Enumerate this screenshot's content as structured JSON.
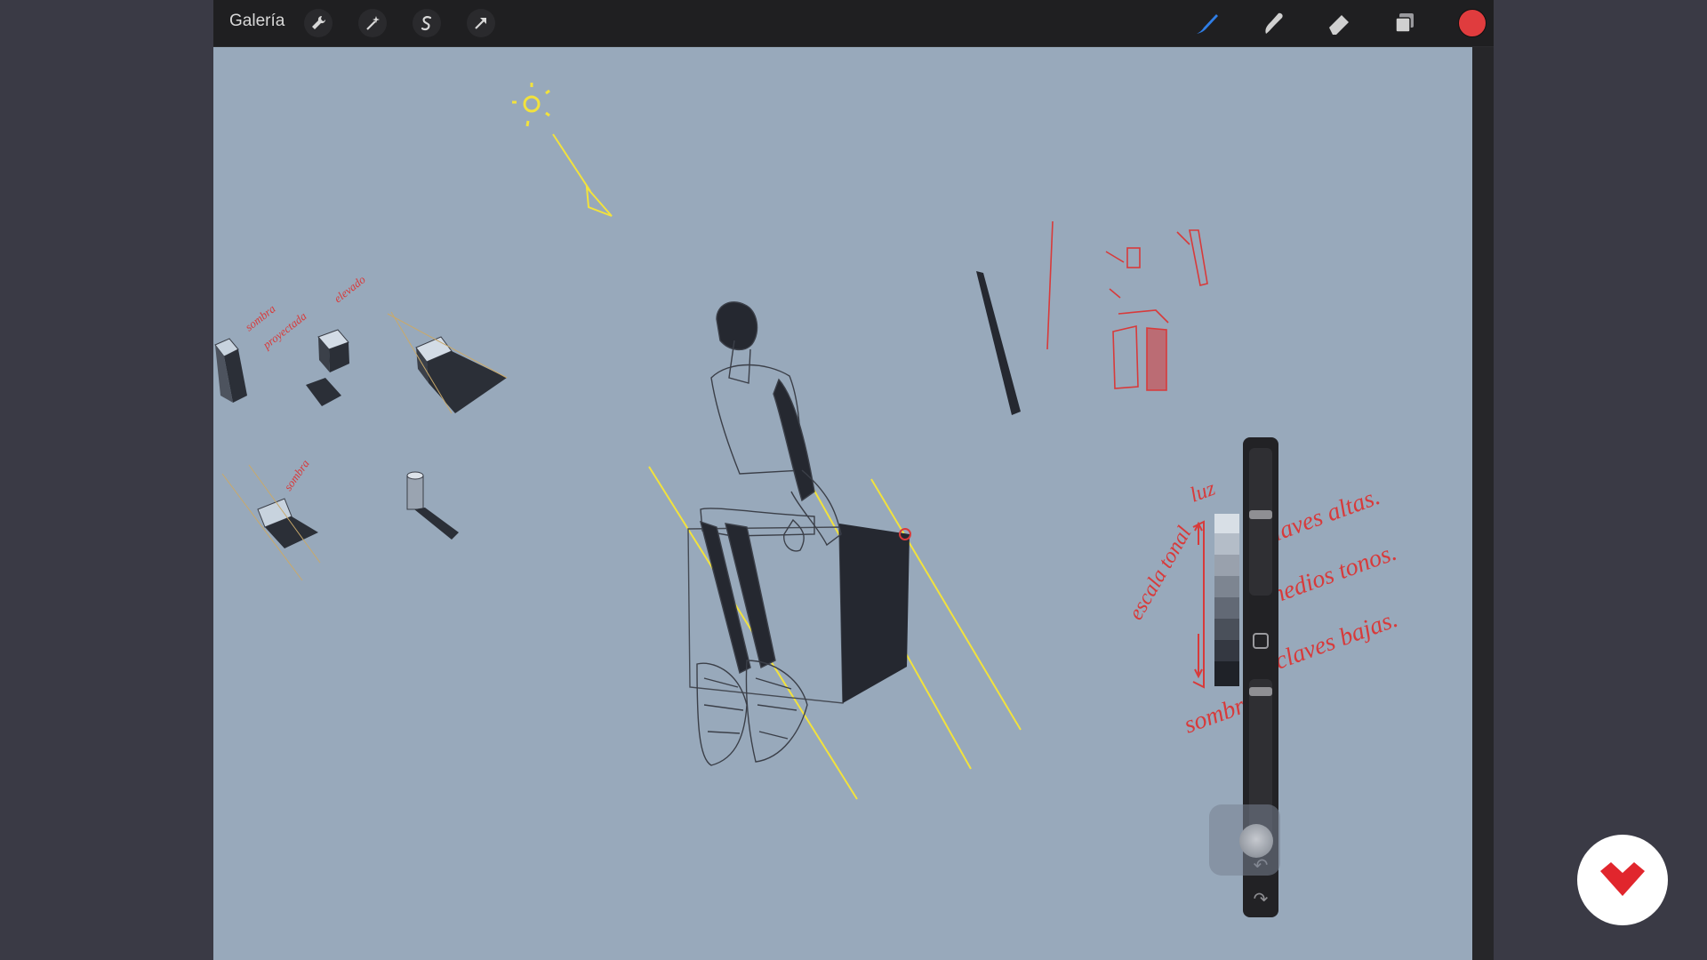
{
  "toolbar": {
    "gallery_label": "Galería",
    "left_tools": [
      "wrench-icon",
      "magic-wand-icon",
      "selection-s-icon",
      "transform-arrow-icon"
    ],
    "right_tools": [
      "brush-icon",
      "smudge-icon",
      "eraser-icon",
      "layers-icon"
    ],
    "current_color": "#e03c3e"
  },
  "canvas": {
    "background_color": "#98a9bb",
    "annotations": {
      "top_left_1": "sombra",
      "top_left_2": "proyectada",
      "top_left_3": "elevado",
      "middle_left": "sombra",
      "escala": "escala tonal",
      "luz": "luz",
      "claves_altas": "claves altas.",
      "medios_tonos": "medios tonos.",
      "claves_bajas": "claves bajas.",
      "sombra_bottom": "sombra."
    }
  },
  "sidebar": {
    "brush_size_level": 0.45,
    "opacity_level": 0.05
  },
  "badge": {
    "brand_color": "#e1262d"
  }
}
